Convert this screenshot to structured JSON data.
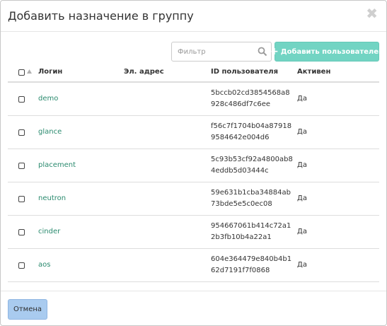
{
  "modal": {
    "title": "Добавить назначение в группу",
    "close_glyph": "✖"
  },
  "toolbar": {
    "filter_placeholder": "Фильтр",
    "add_users_label": "Добавить пользователей",
    "add_icon": "+"
  },
  "table": {
    "columns": {
      "login": "Логин",
      "email": "Эл. адрес",
      "user_id": "ID пользователя",
      "active": "Активен"
    },
    "rows": [
      {
        "login": "demo",
        "email": "",
        "user_id": "5bccb02cd3854568a8928c486df7c6ee",
        "active": "Да"
      },
      {
        "login": "glance",
        "email": "",
        "user_id": "f56c7f1704b04a879189584642e004d6",
        "active": "Да"
      },
      {
        "login": "placement",
        "email": "",
        "user_id": "5c93b53cf92a4800ab84eddb5d03444c",
        "active": "Да"
      },
      {
        "login": "neutron",
        "email": "",
        "user_id": "59e631b1cba34884ab73bde5e5c0ec08",
        "active": "Да"
      },
      {
        "login": "cinder",
        "email": "",
        "user_id": "954667061b414c72a12b3fb10b4a22a1",
        "active": "Да"
      },
      {
        "login": "aos",
        "email": "",
        "user_id": "604e364479e840b4b162d7191f7f0868",
        "active": "Да"
      }
    ]
  },
  "footer": {
    "cancel_label": "Отмена"
  },
  "colors": {
    "accent": "#72d4c3",
    "link": "#2a8a6e",
    "cancel_button": "#a9cbef"
  }
}
